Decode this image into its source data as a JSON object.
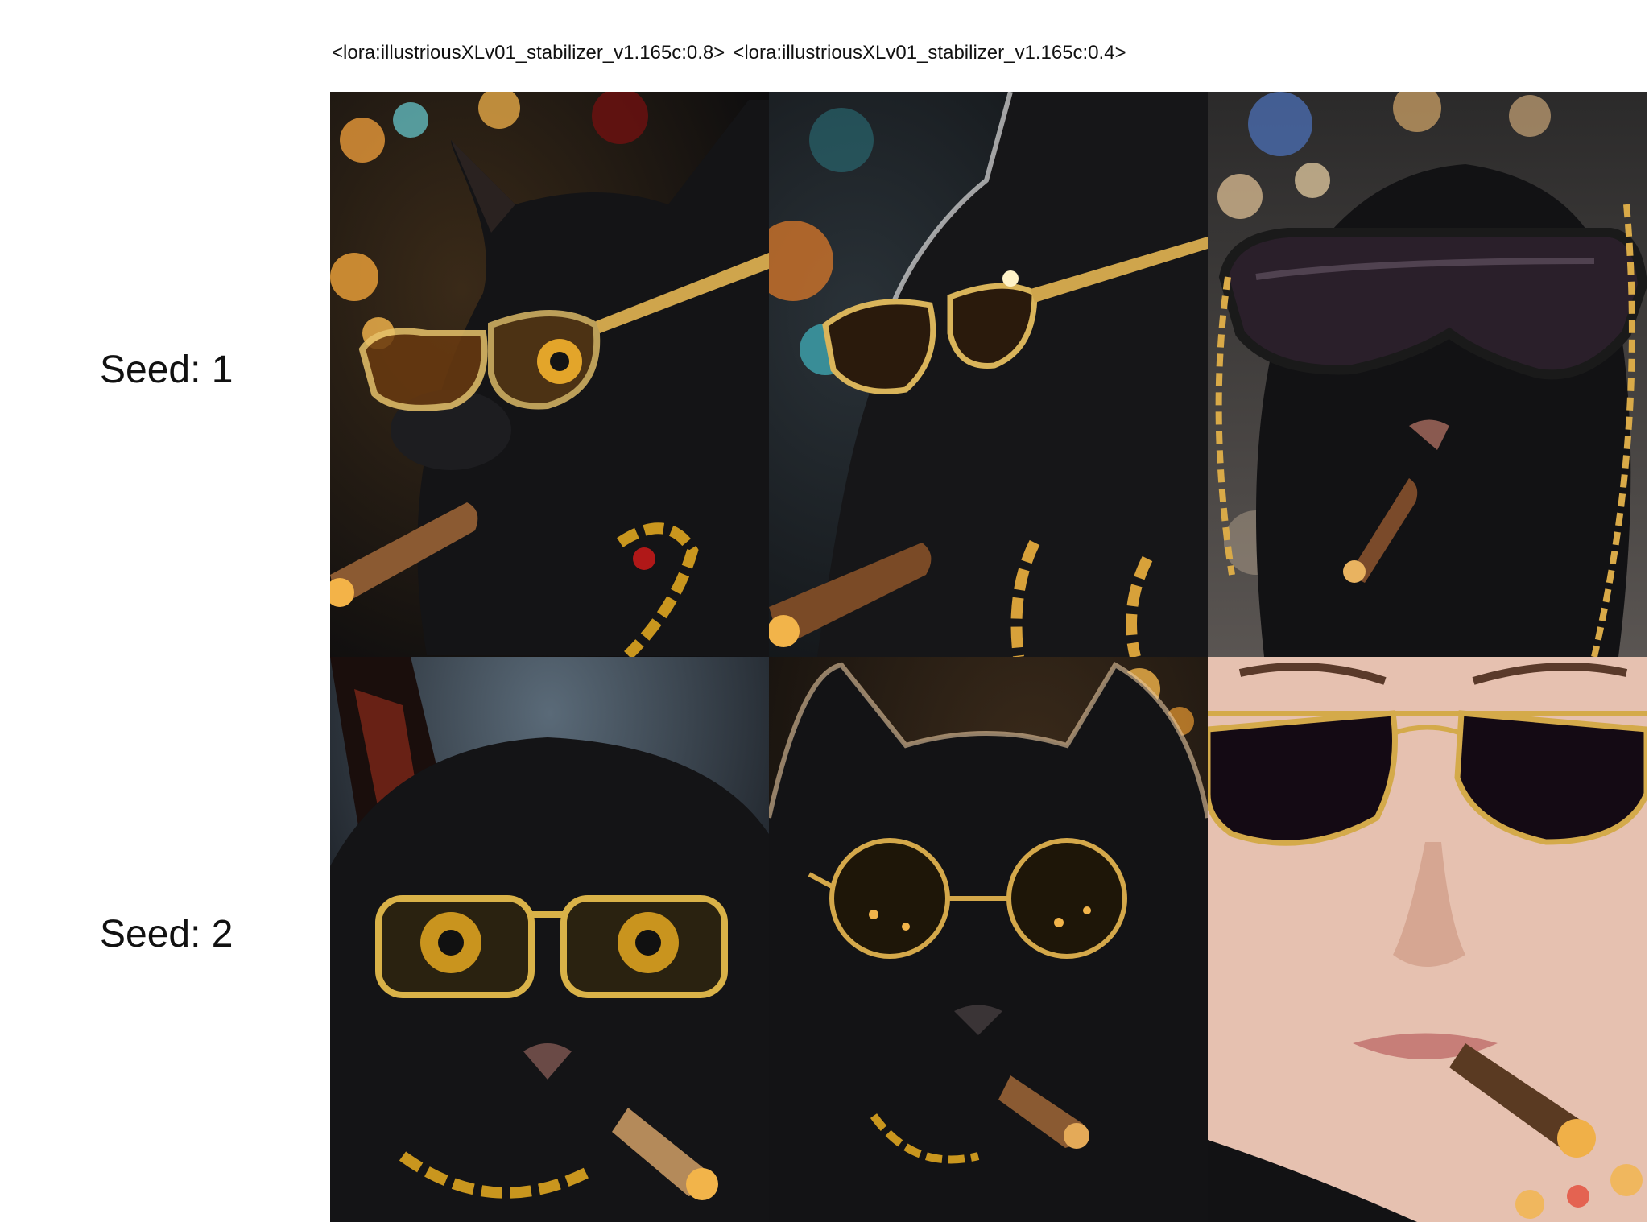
{
  "grid": {
    "column_headers": [
      "<lora:illustriousXLv01_stabilizer_v1.165c:0.8>",
      "<lora:illustriousXLv01_stabilizer_v1.165c:0.4>"
    ],
    "row_labels": [
      "Seed: 1",
      "Seed: 2"
    ]
  }
}
